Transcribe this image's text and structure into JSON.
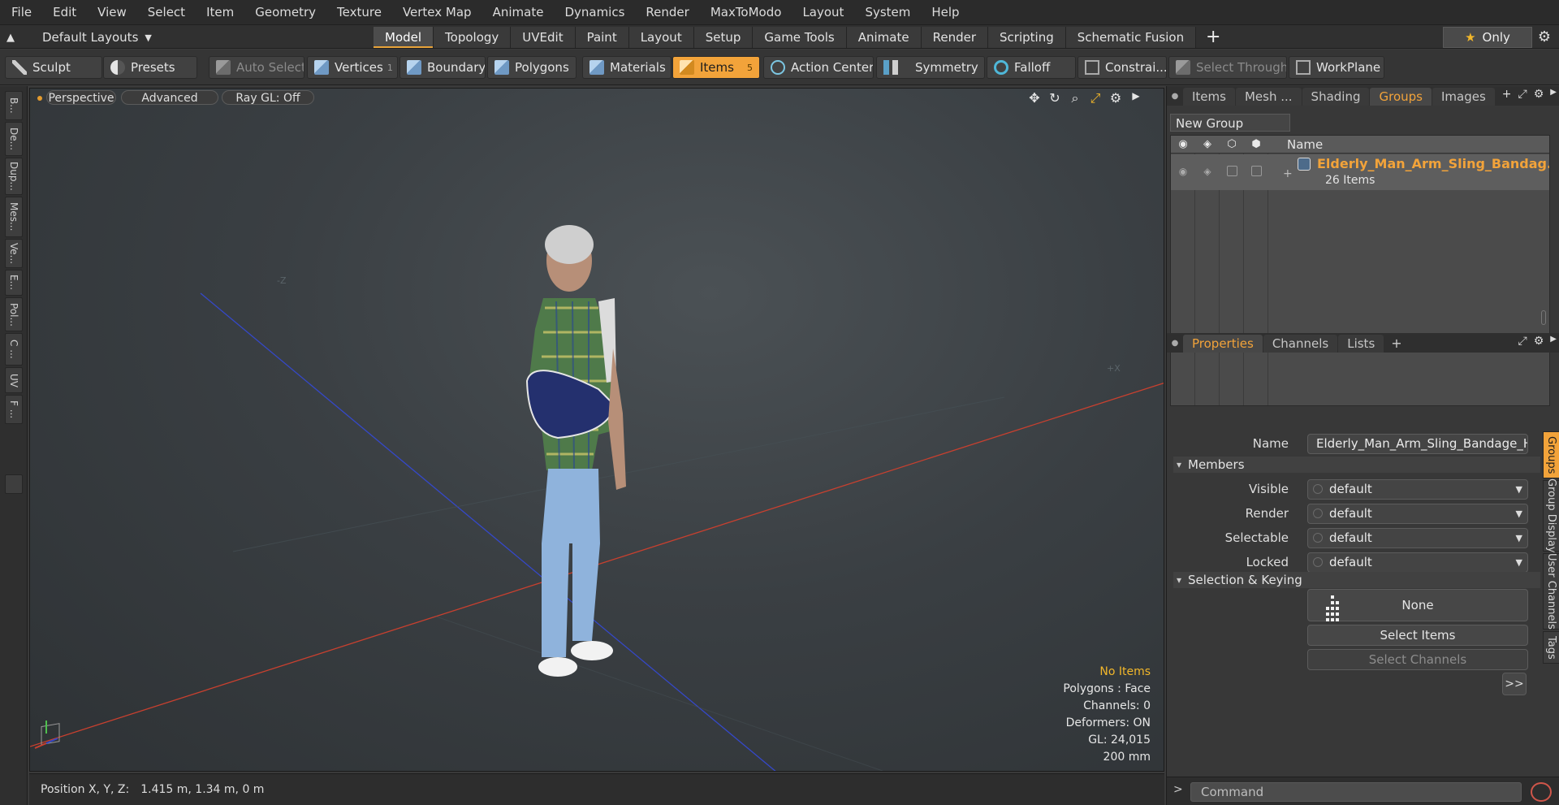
{
  "menu": [
    "File",
    "Edit",
    "View",
    "Select",
    "Item",
    "Geometry",
    "Texture",
    "Vertex Map",
    "Animate",
    "Dynamics",
    "Render",
    "MaxToModo",
    "Layout",
    "System",
    "Help"
  ],
  "layoutbar": {
    "layout_dropdown": "Default Layouts",
    "tabs": [
      "Model",
      "Topology",
      "UVEdit",
      "Paint",
      "Layout",
      "Setup",
      "Game Tools",
      "Animate",
      "Render",
      "Scripting",
      "Schematic Fusion"
    ],
    "active_tab": "Model",
    "only_label": "Only"
  },
  "toolbar": {
    "sculpt": "Sculpt",
    "presets": "Presets",
    "auto_select": "Auto Select",
    "vertices": "Vertices",
    "vertices_count": "1",
    "boundary": "Boundary",
    "polygons": "Polygons",
    "materials": "Materials",
    "items": "Items",
    "items_count": "5",
    "action_center": "Action Center",
    "symmetry": "Symmetry",
    "falloff": "Falloff",
    "constraints": "Constrai...",
    "select_through": "Select Through",
    "workplane": "WorkPlane"
  },
  "leftstrip": [
    "B...",
    "De...",
    "Dup...",
    "Mes...",
    "Ve...",
    "E...",
    "Pol...",
    "C ...",
    "UV",
    "F ..."
  ],
  "viewport": {
    "view": "Perspective",
    "mode": "Advanced",
    "raygl": "Ray GL: Off",
    "info": {
      "no_items": "No Items",
      "polygons": "Polygons : Face",
      "channels": "Channels: 0",
      "deformers": "Deformers: ON",
      "gl": "GL: 24,015",
      "scale": "200 mm"
    }
  },
  "status": {
    "label": "Position X, Y, Z:",
    "value": "1.415 m, 1.34 m, 0 m"
  },
  "groups_panel": {
    "tabs": [
      "Items",
      "Mesh ...",
      "Shading",
      "Groups",
      "Images"
    ],
    "active_tab": "Groups",
    "new_group": "New Group",
    "col_name": "Name",
    "group_name": "Elderly_Man_Arm_Sling_Bandag...",
    "group_count": "26 Items"
  },
  "properties_panel": {
    "tabs": [
      "Properties",
      "Channels",
      "Lists"
    ],
    "active_tab": "Properties",
    "name_label": "Name",
    "name_value": "Elderly_Man_Arm_Sling_Bandage_Har",
    "members_section": "Members",
    "visible_label": "Visible",
    "visible_value": "default",
    "render_label": "Render",
    "render_value": "default",
    "selectable_label": "Selectable",
    "selectable_value": "default",
    "locked_label": "Locked",
    "locked_value": "default",
    "sel_section": "Selection & Keying",
    "none_label": "None",
    "select_items": "Select Items",
    "select_channels": "Select Channels",
    "more": ">>"
  },
  "side_tabs": [
    "Groups",
    "Group Display",
    "User Channels",
    "Tags"
  ],
  "command": {
    "placeholder": "Command"
  },
  "colors": {
    "accent": "#f2a33a",
    "x_axis": "#c8402f",
    "z_axis": "#3548c8"
  }
}
